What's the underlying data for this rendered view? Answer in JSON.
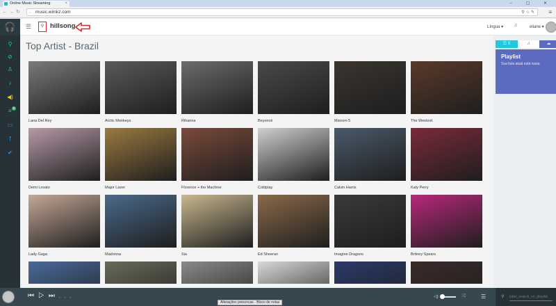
{
  "browser": {
    "tab_title": "Online Music Streaming",
    "url": "music.wiinkz.com",
    "window_controls": "–  ▢  ✕"
  },
  "topbar": {
    "search_query": "hillsong",
    "language_label": "Língua ▾",
    "username": "eliane ▾"
  },
  "page": {
    "title": "Top Artist - Brazil"
  },
  "artists": [
    {
      "name": "Lana Del Rey",
      "tone": "#7a7a7a"
    },
    {
      "name": "Arctic Monkeys",
      "tone": "#5a5a5a"
    },
    {
      "name": "Rihanna",
      "tone": "#6c6c6c"
    },
    {
      "name": "Beyoncé",
      "tone": "#4a4a4a"
    },
    {
      "name": "Maroon 5",
      "tone": "#3a3530"
    },
    {
      "name": "The Weeknd",
      "tone": "#5a3a2a"
    },
    {
      "name": "Demi Lovato",
      "tone": "#b59aa8"
    },
    {
      "name": "Major Lazer",
      "tone": "#9a7a40"
    },
    {
      "name": "Florence + the Machine",
      "tone": "#7a4a3a"
    },
    {
      "name": "Coldplay",
      "tone": "#cfcfcf"
    },
    {
      "name": "Calvin Harris",
      "tone": "#4a5a6a"
    },
    {
      "name": "Katy Perry",
      "tone": "#7a2a3a"
    },
    {
      "name": "Lady Gaga",
      "tone": "#c4a896"
    },
    {
      "name": "Madonna",
      "tone": "#4a6a8a"
    },
    {
      "name": "Sia",
      "tone": "#c9b890"
    },
    {
      "name": "Ed Sheeran",
      "tone": "#8a6a4a"
    },
    {
      "name": "Imagine Dragons",
      "tone": "#3a3a3a"
    },
    {
      "name": "Britney Spears",
      "tone": "#b8287a"
    },
    {
      "name": "",
      "tone": "#4a6a9a"
    },
    {
      "name": "",
      "tone": "#6a6a5a"
    },
    {
      "name": "",
      "tone": "#8a8a8a"
    },
    {
      "name": "",
      "tone": "#d8d8d8"
    },
    {
      "name": "",
      "tone": "#2a3a6a"
    },
    {
      "name": "",
      "tone": "#3a2a2a"
    }
  ],
  "sidebar_right": {
    "tabs": [
      "☰ 0",
      "♫",
      "☁"
    ],
    "playlist_title": "Playlist",
    "playlist_message": "Sua lista atual está vazia."
  },
  "left_nav_badge": "6",
  "player": {
    "elapsed": "...",
    "tooltip": "Alterações prescncas - Bloco de notas",
    "search_placeholder": "label_search_on_playlist"
  },
  "colors": {
    "accent": "#2bd5d9",
    "leftbar": "#263238",
    "playlist_card": "#5c6bc0",
    "highlight_box": "#d9262b",
    "player_bar": "#37474f"
  }
}
